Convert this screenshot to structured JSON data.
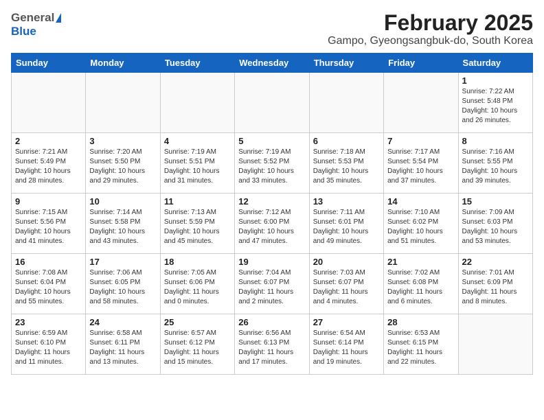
{
  "header": {
    "logo_general": "General",
    "logo_blue": "Blue",
    "month_year": "February 2025",
    "location": "Gampo, Gyeongsangbuk-do, South Korea"
  },
  "weekdays": [
    "Sunday",
    "Monday",
    "Tuesday",
    "Wednesday",
    "Thursday",
    "Friday",
    "Saturday"
  ],
  "weeks": [
    [
      {
        "day": "",
        "info": ""
      },
      {
        "day": "",
        "info": ""
      },
      {
        "day": "",
        "info": ""
      },
      {
        "day": "",
        "info": ""
      },
      {
        "day": "",
        "info": ""
      },
      {
        "day": "",
        "info": ""
      },
      {
        "day": "1",
        "info": "Sunrise: 7:22 AM\nSunset: 5:48 PM\nDaylight: 10 hours\nand 26 minutes."
      }
    ],
    [
      {
        "day": "2",
        "info": "Sunrise: 7:21 AM\nSunset: 5:49 PM\nDaylight: 10 hours\nand 28 minutes."
      },
      {
        "day": "3",
        "info": "Sunrise: 7:20 AM\nSunset: 5:50 PM\nDaylight: 10 hours\nand 29 minutes."
      },
      {
        "day": "4",
        "info": "Sunrise: 7:19 AM\nSunset: 5:51 PM\nDaylight: 10 hours\nand 31 minutes."
      },
      {
        "day": "5",
        "info": "Sunrise: 7:19 AM\nSunset: 5:52 PM\nDaylight: 10 hours\nand 33 minutes."
      },
      {
        "day": "6",
        "info": "Sunrise: 7:18 AM\nSunset: 5:53 PM\nDaylight: 10 hours\nand 35 minutes."
      },
      {
        "day": "7",
        "info": "Sunrise: 7:17 AM\nSunset: 5:54 PM\nDaylight: 10 hours\nand 37 minutes."
      },
      {
        "day": "8",
        "info": "Sunrise: 7:16 AM\nSunset: 5:55 PM\nDaylight: 10 hours\nand 39 minutes."
      }
    ],
    [
      {
        "day": "9",
        "info": "Sunrise: 7:15 AM\nSunset: 5:56 PM\nDaylight: 10 hours\nand 41 minutes."
      },
      {
        "day": "10",
        "info": "Sunrise: 7:14 AM\nSunset: 5:58 PM\nDaylight: 10 hours\nand 43 minutes."
      },
      {
        "day": "11",
        "info": "Sunrise: 7:13 AM\nSunset: 5:59 PM\nDaylight: 10 hours\nand 45 minutes."
      },
      {
        "day": "12",
        "info": "Sunrise: 7:12 AM\nSunset: 6:00 PM\nDaylight: 10 hours\nand 47 minutes."
      },
      {
        "day": "13",
        "info": "Sunrise: 7:11 AM\nSunset: 6:01 PM\nDaylight: 10 hours\nand 49 minutes."
      },
      {
        "day": "14",
        "info": "Sunrise: 7:10 AM\nSunset: 6:02 PM\nDaylight: 10 hours\nand 51 minutes."
      },
      {
        "day": "15",
        "info": "Sunrise: 7:09 AM\nSunset: 6:03 PM\nDaylight: 10 hours\nand 53 minutes."
      }
    ],
    [
      {
        "day": "16",
        "info": "Sunrise: 7:08 AM\nSunset: 6:04 PM\nDaylight: 10 hours\nand 55 minutes."
      },
      {
        "day": "17",
        "info": "Sunrise: 7:06 AM\nSunset: 6:05 PM\nDaylight: 10 hours\nand 58 minutes."
      },
      {
        "day": "18",
        "info": "Sunrise: 7:05 AM\nSunset: 6:06 PM\nDaylight: 11 hours\nand 0 minutes."
      },
      {
        "day": "19",
        "info": "Sunrise: 7:04 AM\nSunset: 6:07 PM\nDaylight: 11 hours\nand 2 minutes."
      },
      {
        "day": "20",
        "info": "Sunrise: 7:03 AM\nSunset: 6:07 PM\nDaylight: 11 hours\nand 4 minutes."
      },
      {
        "day": "21",
        "info": "Sunrise: 7:02 AM\nSunset: 6:08 PM\nDaylight: 11 hours\nand 6 minutes."
      },
      {
        "day": "22",
        "info": "Sunrise: 7:01 AM\nSunset: 6:09 PM\nDaylight: 11 hours\nand 8 minutes."
      }
    ],
    [
      {
        "day": "23",
        "info": "Sunrise: 6:59 AM\nSunset: 6:10 PM\nDaylight: 11 hours\nand 11 minutes."
      },
      {
        "day": "24",
        "info": "Sunrise: 6:58 AM\nSunset: 6:11 PM\nDaylight: 11 hours\nand 13 minutes."
      },
      {
        "day": "25",
        "info": "Sunrise: 6:57 AM\nSunset: 6:12 PM\nDaylight: 11 hours\nand 15 minutes."
      },
      {
        "day": "26",
        "info": "Sunrise: 6:56 AM\nSunset: 6:13 PM\nDaylight: 11 hours\nand 17 minutes."
      },
      {
        "day": "27",
        "info": "Sunrise: 6:54 AM\nSunset: 6:14 PM\nDaylight: 11 hours\nand 19 minutes."
      },
      {
        "day": "28",
        "info": "Sunrise: 6:53 AM\nSunset: 6:15 PM\nDaylight: 11 hours\nand 22 minutes."
      },
      {
        "day": "",
        "info": ""
      }
    ]
  ]
}
